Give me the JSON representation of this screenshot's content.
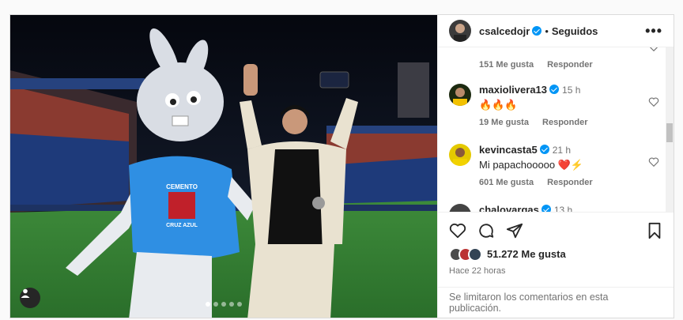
{
  "header": {
    "username": "csalcedojr",
    "separator": "•",
    "following_label": "Seguidos",
    "more_label": "•••"
  },
  "comments": [
    {
      "username": "",
      "time": "",
      "text": "",
      "likes": "151 Me gusta",
      "reply": "Responder"
    },
    {
      "username": "maxiolivera13",
      "time": "15 h",
      "text": "🔥🔥🔥",
      "likes": "19 Me gusta",
      "reply": "Responder"
    },
    {
      "username": "kevincasta5",
      "time": "21 h",
      "text": "Mi papachooooo ❤️⚡",
      "likes": "601 Me gusta",
      "reply": "Responder"
    },
    {
      "username": "chalovargas",
      "time": "13 h",
      "text": "",
      "likes": "",
      "reply": ""
    }
  ],
  "post": {
    "likes": "51.272 Me gusta",
    "time_ago": "Hace 22 horas",
    "comments_limited": "Se limitaron los comentarios en esta publicación."
  },
  "photo": {
    "jersey_text": "CEMENTO",
    "badge_text": "CRUZ AZUL",
    "carousel_dots": 5,
    "active_dot": 1
  },
  "colors": {
    "verified": "#0095f6",
    "accent_blue": "#1e90ff"
  },
  "icons": [
    "more-icon",
    "heart-icon",
    "comment-icon",
    "share-icon",
    "bookmark-icon",
    "user-tag-icon",
    "verified-icon"
  ]
}
